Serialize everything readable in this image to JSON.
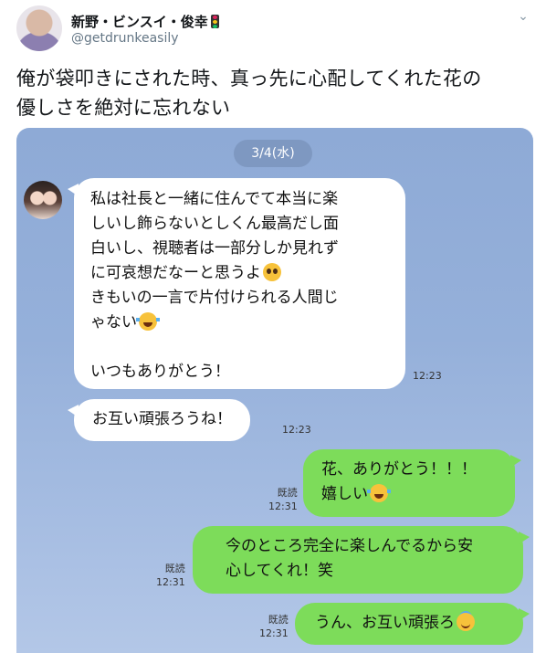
{
  "tweet": {
    "display_name": "新野・ビンスイ・俊幸",
    "handle": "@getdrunkeasily",
    "text_line1": "俺が袋叩きにされた時、真っ先に心配してくれた花の",
    "text_line2": "優しさを絶対に忘れない"
  },
  "chat": {
    "date": "3/4(水)",
    "messages": [
      {
        "side": "incoming",
        "lines": [
          "私は社長と一緒に住んでて本当に楽",
          "しいし飾らないとしくん最高だし面",
          "白いし、視聴者は一部分しか見れず",
          "に可哀想だなーと思うよ",
          "きもいの一言で片付けられる人間じ",
          "ゃない",
          "",
          "いつもありがとう！"
        ],
        "time": "12:23"
      },
      {
        "side": "incoming",
        "lines": [
          "お互い頑張ろうね！"
        ],
        "time": "12:23"
      },
      {
        "side": "outgoing",
        "lines": [
          "花、ありがとう！！！",
          "嬉しい"
        ],
        "read": "既読",
        "time": "12:31"
      },
      {
        "side": "outgoing",
        "lines": [
          "今のところ完全に楽しんでるから安",
          "心してくれ！笑"
        ],
        "read": "既読",
        "time": "12:31"
      },
      {
        "side": "outgoing",
        "lines": [
          "うん、お互い頑張ろ"
        ],
        "read": "既読",
        "time": "12:31"
      }
    ]
  },
  "icons": {
    "name_badge": "traffic-light-icon",
    "menu": "chevron-down-icon",
    "emoji": [
      "pleading-face-icon",
      "face-with-tears-of-joy-icon",
      "smiling-face-with-halo-icon"
    ]
  },
  "colors": {
    "chat_background": "#8eaad6",
    "outgoing_bubble": "#7ddc5a",
    "incoming_bubble": "#ffffff",
    "handle_text": "#657786"
  }
}
